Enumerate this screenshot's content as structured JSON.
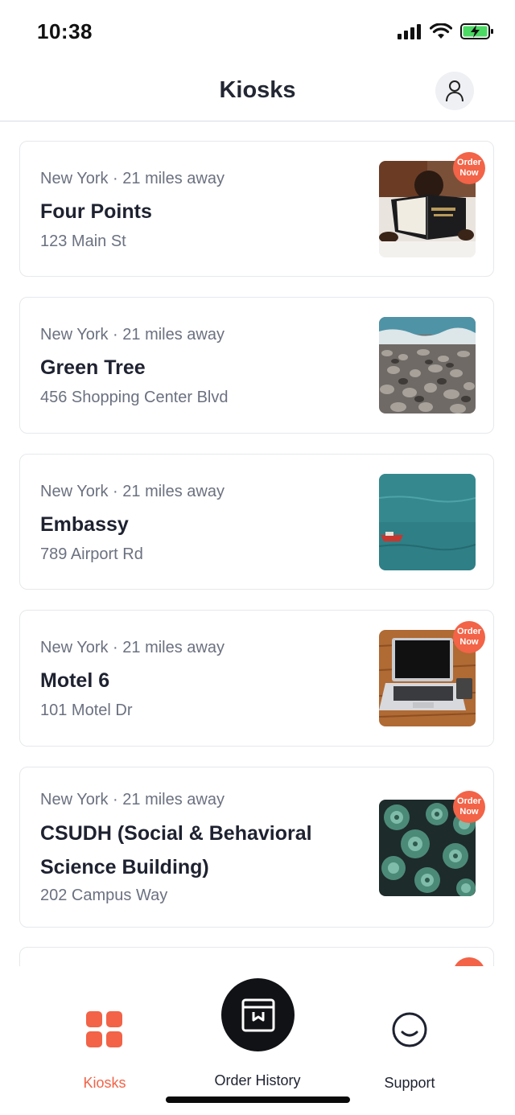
{
  "status": {
    "time": "10:38"
  },
  "header": {
    "title": "Kiosks"
  },
  "kiosks": [
    {
      "meta": "New York · 21 miles away",
      "name": "Four Points",
      "address": "123 Main St",
      "badge": "Order Now",
      "image": "bible-photo"
    },
    {
      "meta": "New York · 21 miles away",
      "name": "Green Tree",
      "address": "456 Shopping Center Blvd",
      "badge": "",
      "image": "pebbles-photo"
    },
    {
      "meta": "New York · 21 miles away",
      "name": "Embassy",
      "address": "789 Airport Rd",
      "badge": "",
      "image": "sea-boat-photo"
    },
    {
      "meta": "New York · 21 miles away",
      "name": "Motel 6",
      "address": "101 Motel Dr",
      "badge": "Order Now",
      "image": "laptop-photo"
    },
    {
      "meta": "New York · 21 miles away",
      "name": "CSUDH (Social & Behavioral Science Building)",
      "address": "202 Campus Way",
      "badge": "Order Now",
      "image": "succulents-photo"
    }
  ],
  "tabs": {
    "kiosks": "Kiosks",
    "order_history": "Order History",
    "support": "Support"
  },
  "colors": {
    "accent": "#f26347",
    "text": "#1e2230",
    "muted": "#6b7180"
  }
}
